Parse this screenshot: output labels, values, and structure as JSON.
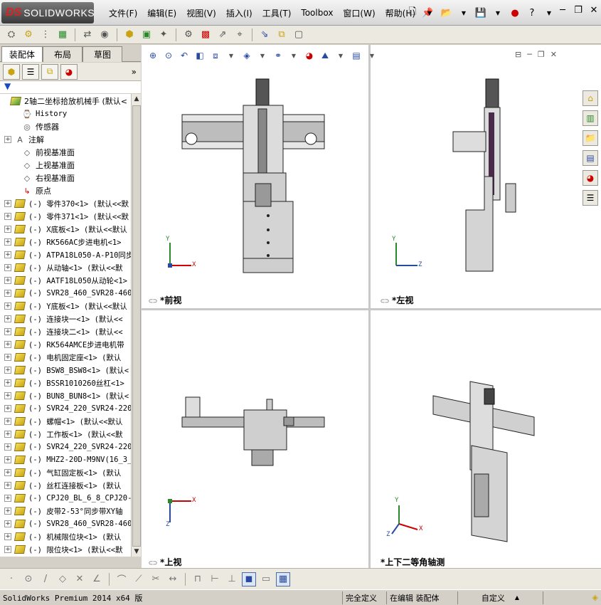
{
  "app": {
    "logo_ds": "DS",
    "logo_name": "SOLIDWORKS"
  },
  "menu": [
    "文件(F)",
    "编辑(E)",
    "视图(V)",
    "插入(I)",
    "工具(T)",
    "Toolbox",
    "窗口(W)",
    "帮助(H)"
  ],
  "left_tabs": [
    "装配体",
    "布局",
    "草图"
  ],
  "tree": {
    "root": "2轴二坐标拾放机械手  (默认<",
    "items": [
      {
        "label": "History",
        "icon": "history-icon",
        "exp": false
      },
      {
        "label": "传感器",
        "icon": "sensor-icon",
        "exp": false
      },
      {
        "label": "注解",
        "icon": "annotation-icon",
        "exp": true
      },
      {
        "label": "前视基准面",
        "icon": "plane-icon",
        "exp": false
      },
      {
        "label": "上视基准面",
        "icon": "plane-icon",
        "exp": false
      },
      {
        "label": "右视基准面",
        "icon": "plane-icon",
        "exp": false
      },
      {
        "label": "原点",
        "icon": "origin-icon",
        "exp": false
      },
      {
        "label": "(-) 零件370<1> (默认<<默",
        "icon": "part-icon",
        "exp": true
      },
      {
        "label": "(-) 零件371<1> (默认<<默",
        "icon": "part-icon",
        "exp": true
      },
      {
        "label": "(-) X底板<1> (默认<<默认",
        "icon": "part-icon",
        "exp": true
      },
      {
        "label": "(-) RK566AC步进电机<1>",
        "icon": "part-icon",
        "exp": true
      },
      {
        "label": "(-) ATPA18L050-A-P10同步",
        "icon": "part-icon",
        "exp": true
      },
      {
        "label": "(-) 从动轴<1> (默认<<默",
        "icon": "part-icon",
        "exp": true
      },
      {
        "label": "(-) AATF18L050从动轮<1>",
        "icon": "part-icon",
        "exp": true
      },
      {
        "label": "(-) SVR28_460_SVR28-460",
        "icon": "part-icon",
        "exp": true
      },
      {
        "label": "(-) Y底板<1> (默认<<默认",
        "icon": "part-icon",
        "exp": true
      },
      {
        "label": "(-) 连接块一<1> (默认<<",
        "icon": "part-icon",
        "exp": true
      },
      {
        "label": "(-) 连接块二<1> (默认<<",
        "icon": "part-icon",
        "exp": true
      },
      {
        "label": "(-) RK564AMCE步进电机带",
        "icon": "part-icon",
        "exp": true
      },
      {
        "label": "(-) 电机固定座<1> (默认",
        "icon": "part-icon",
        "exp": true
      },
      {
        "label": "(-) BSW8_BSW8<1> (默认<",
        "icon": "part-icon",
        "exp": true
      },
      {
        "label": "(-) BSSR1010260丝杠<1>",
        "icon": "part-icon",
        "exp": true
      },
      {
        "label": "(-) BUN8_BUN8<1> (默认<",
        "icon": "part-icon",
        "exp": true
      },
      {
        "label": "(-) SVR24_220_SVR24-220",
        "icon": "part-icon",
        "exp": true
      },
      {
        "label": "(-) 螺帽<1> (默认<<默认",
        "icon": "part-icon",
        "exp": true
      },
      {
        "label": "(-) 工作板<1> (默认<<默",
        "icon": "part-icon",
        "exp": true
      },
      {
        "label": "(-) SVR24_220_SVR24-220",
        "icon": "part-icon",
        "exp": true
      },
      {
        "label": "(-) MHZ2-20D-M9NV(16_3_",
        "icon": "part-icon",
        "exp": true
      },
      {
        "label": "(-) 气缸固定板<1> (默认",
        "icon": "part-icon",
        "exp": true
      },
      {
        "label": "(-) 丝杠连接板<1> (默认",
        "icon": "part-icon",
        "exp": true
      },
      {
        "label": "(-) CPJ20_BL_6_8_CPJ20-",
        "icon": "part-icon",
        "exp": true
      },
      {
        "label": "(-) 皮带2-53°同步带XY轴",
        "icon": "part-icon",
        "exp": true
      },
      {
        "label": "(-) SVR28_460_SVR28-460",
        "icon": "part-icon",
        "exp": true
      },
      {
        "label": "(-) 机械限位块<1> (默认",
        "icon": "part-icon",
        "exp": true
      },
      {
        "label": "(-) 限位块<1> (默认<<默",
        "icon": "part-icon",
        "exp": true
      }
    ]
  },
  "viewports": {
    "front": "*前视",
    "left": "*左视",
    "top": "*上视",
    "iso": "*上下二等角轴测"
  },
  "axes": {
    "x": "X",
    "y": "Y",
    "z": "Z"
  },
  "status": {
    "app_version": "SolidWorks Premium 2014 x64 版",
    "defined": "完全定义",
    "editing": "在编辑 装配体",
    "custom": "自定义"
  }
}
